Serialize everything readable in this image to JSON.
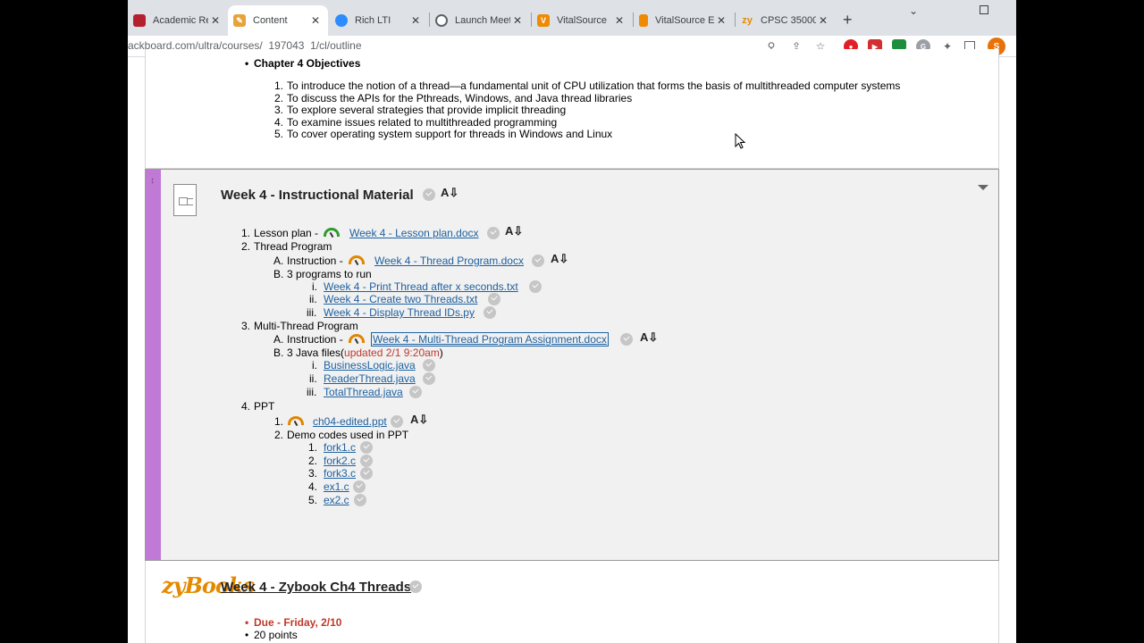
{
  "tabs": [
    {
      "label": "Academic Re",
      "fav_text": "",
      "fav_color": "#b5202e"
    },
    {
      "label": "Content",
      "fav_text": "",
      "fav_color": "#e6a33a"
    },
    {
      "label": "Rich LTI",
      "fav_text": "",
      "fav_color": "#2d8cff"
    },
    {
      "label": "Launch Meet",
      "fav_text": "",
      "fav_color": "#5f6368"
    },
    {
      "label": "VitalSource",
      "fav_text": "V",
      "fav_color": "#f08a00"
    },
    {
      "label": "VitalSource E",
      "fav_text": "",
      "fav_color": "#f08a00"
    },
    {
      "label": "CPSC 35000",
      "fav_text": "zy",
      "fav_color": "#e58a00"
    }
  ],
  "toolbar": {
    "url": "ackboard.com/ultra/courses/_197043_1/cl/outline",
    "profile_initial": "S"
  },
  "objectives": {
    "heading": "Chapter 4 Objectives",
    "items": [
      "To introduce the notion of a thread—a fundamental unit of CPU utilization that forms the basis of multithreaded computer systems",
      "To discuss the APIs for the Pthreads, Windows, and Java thread libraries",
      "To explore several strategies that provide implicit threading",
      "To examine issues related to multithreaded programming",
      "To cover operating system support for threads in Windows and Linux"
    ]
  },
  "week4": {
    "title": "Week 4 - Instructional Material",
    "lesson_plan_label": "Lesson plan -",
    "lesson_plan_link": "Week 4 - Lesson plan.docx",
    "thread_program": "Thread Program",
    "instruction_label": "Instruction -",
    "thread_program_link": "Week 4 - Thread Program.docx",
    "programs_label": "3 programs to run",
    "programs": [
      "Week 4 - Print Thread after x seconds.txt",
      "Week 4 - Create two Threads.txt",
      "Week 4 - Display Thread IDs.py"
    ],
    "multi_thread": "Multi-Thread Program",
    "multi_link": "Week 4 - Multi-Thread Program Assignment.docx",
    "java_label": "3 Java files(",
    "java_updated": "updated 2/1 9:20am",
    "java_close": ")",
    "java_files": [
      "BusinessLogic.java",
      "ReaderThread.java",
      "TotalThread.java"
    ],
    "ppt": "PPT",
    "ppt_link": "ch04-edited.ppt",
    "demo_label": "Demo codes used in PPT",
    "demo_files": [
      "fork1.c",
      "fork2.c",
      "fork3.c",
      "ex1.c",
      "ex2.c"
    ]
  },
  "zybook": {
    "logo": "zyBooks",
    "title": "Week 4 - Zybook Ch4 Threads",
    "due": "Due - Friday, 2/10",
    "points": "20 points"
  },
  "markers": {
    "num": [
      "1.",
      "2.",
      "3.",
      "4.",
      "5."
    ],
    "alpha": [
      "A.",
      "B."
    ],
    "roman": [
      "i.",
      "ii.",
      "iii."
    ]
  }
}
